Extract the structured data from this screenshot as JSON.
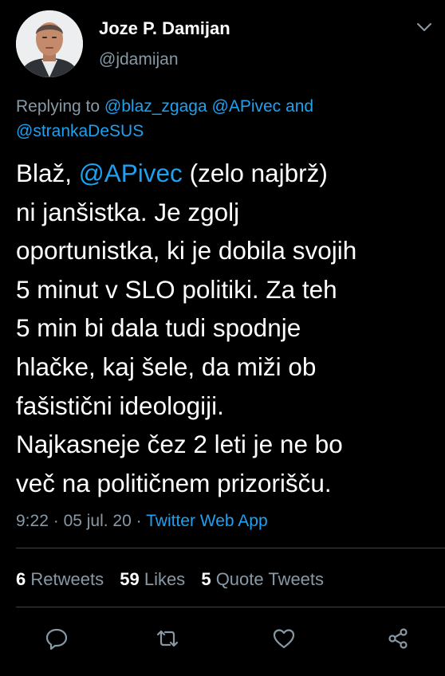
{
  "author": {
    "display_name": "Joze P. Damijan",
    "handle": "@jdamijan"
  },
  "reply_context": {
    "prefix": "Replying to",
    "mention_1": "@blaz_zgaga",
    "mention_2": "@APivec",
    "joiner": "and",
    "mention_3": "@strankaDeSUS"
  },
  "tweet": {
    "line_1_start": "Blaž,",
    "line_1_mention": "@APivec",
    "line_1_end": "(zelo najbrž)",
    "line_2": "ni janšistka. Je zgolj",
    "line_3": "oportunistka, ki je dobila svojih",
    "line_4": "5 minut v SLO politiki. Za teh",
    "line_5": "5 min bi dala tudi spodnje",
    "line_6": "hlačke, kaj šele, da miži ob",
    "line_7": "fašistični ideologiji.",
    "line_8": "Najkasneje čez 2 leti je ne bo",
    "line_9": "več na političnem prizorišču."
  },
  "meta": {
    "time": "9:22",
    "separator": "·",
    "date": "05 jul. 20",
    "source": "Twitter Web App"
  },
  "stats": {
    "retweets_count": "6",
    "retweets_label": "Retweets",
    "likes_count": "59",
    "likes_label": "Likes",
    "quotes_count": "5",
    "quotes_label": "Quote Tweets"
  },
  "icons": {
    "caret": "chevron-down-icon",
    "reply": "reply-icon",
    "retweet": "retweet-icon",
    "like": "heart-icon",
    "share": "share-icon"
  },
  "colors": {
    "background": "#000000",
    "text": "#ffffff",
    "secondary": "#8899a6",
    "accent": "#1da1f2",
    "divider": "#38444d"
  }
}
